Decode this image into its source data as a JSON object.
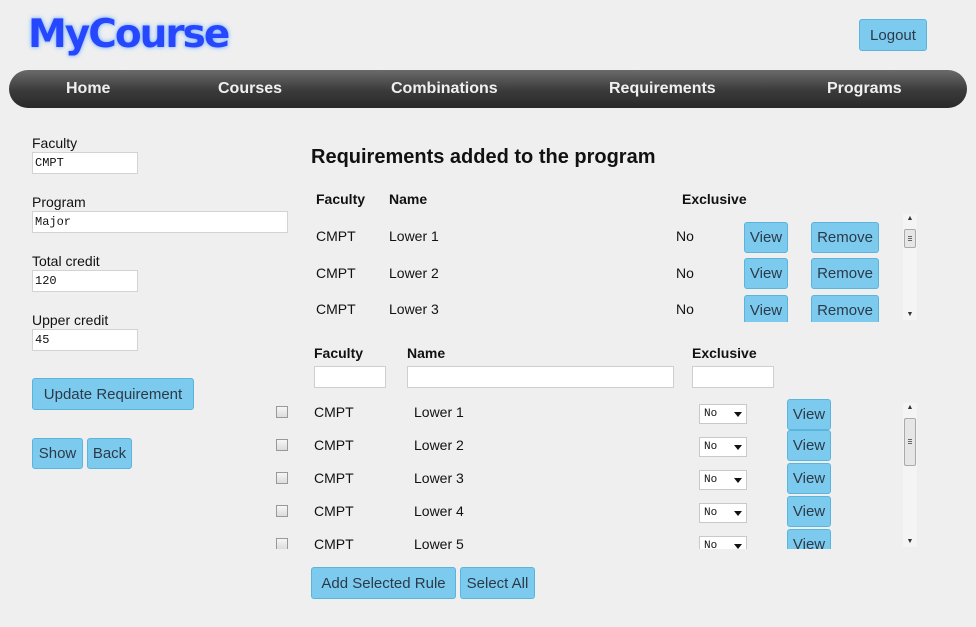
{
  "app": {
    "logo": "MyCourse",
    "logout_label": "Logout"
  },
  "nav": {
    "items": [
      "Home",
      "Courses",
      "Combinations",
      "Requirements",
      "Programs"
    ]
  },
  "form": {
    "faculty": {
      "label": "Faculty",
      "value": "CMPT"
    },
    "program": {
      "label": "Program",
      "value": "Major"
    },
    "total_credit": {
      "label": "Total credit",
      "value": "120"
    },
    "upper_credit": {
      "label": "Upper credit",
      "value": "45"
    },
    "update_label": "Update Requirement",
    "show_label": "Show",
    "back_label": "Back"
  },
  "added": {
    "title": "Requirements added to the program",
    "headers": {
      "faculty": "Faculty",
      "name": "Name",
      "exclusive": "Exclusive"
    },
    "view_label": "View",
    "remove_label": "Remove",
    "rows": [
      {
        "faculty": "CMPT",
        "name": "Lower 1",
        "exclusive": "No"
      },
      {
        "faculty": "CMPT",
        "name": "Lower 2",
        "exclusive": "No"
      },
      {
        "faculty": "CMPT",
        "name": "Lower 3",
        "exclusive": "No"
      }
    ]
  },
  "available": {
    "headers": {
      "faculty": "Faculty",
      "name": "Name",
      "exclusive": "Exclusive"
    },
    "view_label": "View",
    "rows": [
      {
        "faculty": "CMPT",
        "name": "Lower 1",
        "exclusive": "No"
      },
      {
        "faculty": "CMPT",
        "name": "Lower 2",
        "exclusive": "No"
      },
      {
        "faculty": "CMPT",
        "name": "Lower 3",
        "exclusive": "No"
      },
      {
        "faculty": "CMPT",
        "name": "Lower 4",
        "exclusive": "No"
      },
      {
        "faculty": "CMPT",
        "name": "Lower 5",
        "exclusive": "No"
      }
    ],
    "add_label": "Add Selected Rule",
    "select_all_label": "Select All"
  },
  "icons": {
    "scroll_up": "scroll-up-arrow-icon",
    "scroll_down": "scroll-down-arrow-icon",
    "dropdown": "chevron-down-icon"
  }
}
